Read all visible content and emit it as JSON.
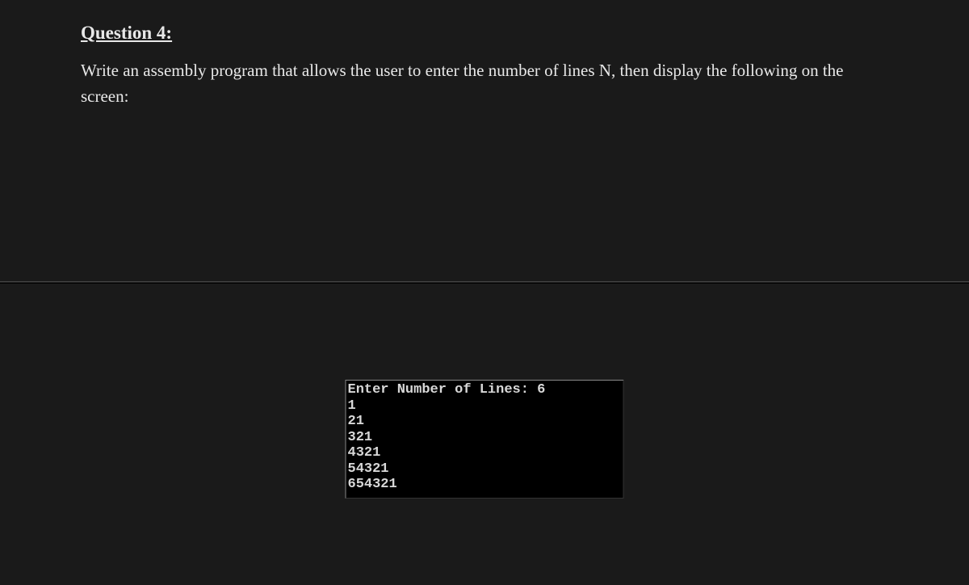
{
  "question": {
    "heading": "Question 4:",
    "body": "Write an assembly program that allows the user to enter the number of lines N, then display the following on the screen:"
  },
  "console": {
    "lines": [
      "Enter Number of Lines: 6",
      "1",
      "21",
      "321",
      "4321",
      "54321",
      "654321"
    ]
  }
}
